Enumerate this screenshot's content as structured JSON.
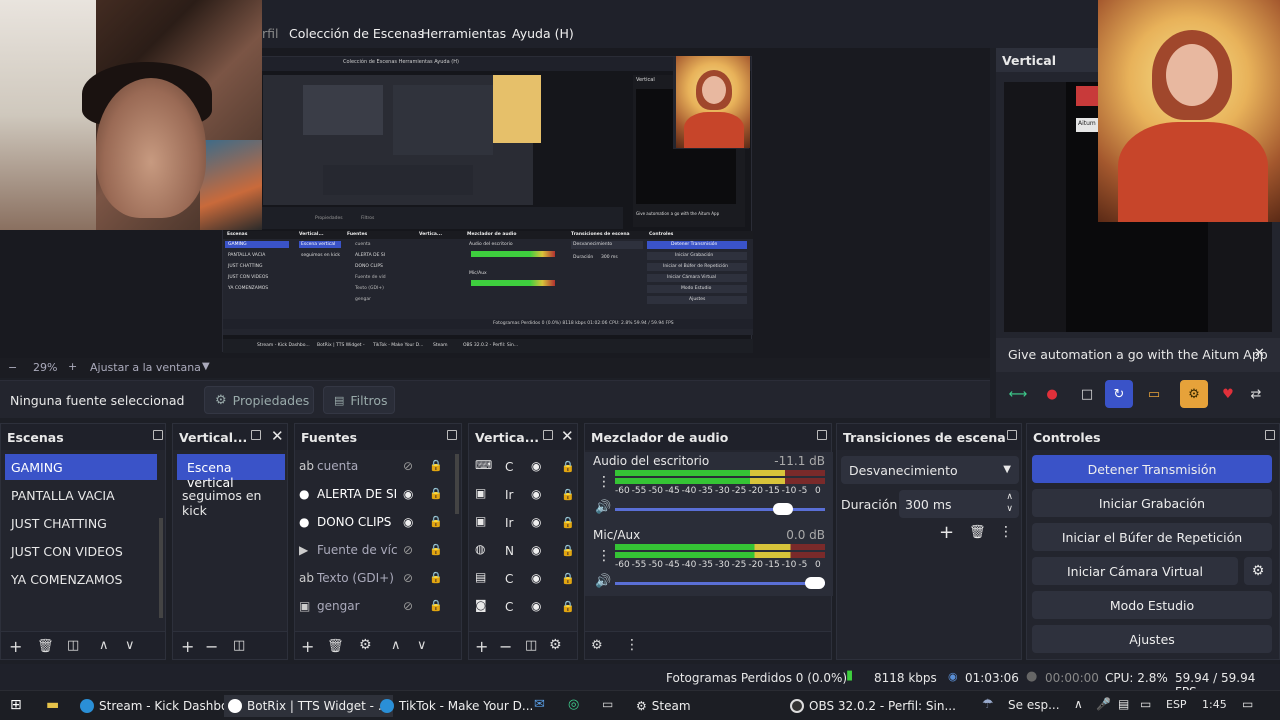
{
  "menu": {
    "partial": "rfil",
    "items": [
      "Colección de Escenas",
      "Herramientas",
      "Ayuda (H)"
    ]
  },
  "zoom": {
    "minus": "−",
    "value": "29%",
    "plus": "+",
    "fit_label": "Ajustar a la ventana",
    "chev": "▼"
  },
  "properties_bar": {
    "no_source": "Ninguna fuente seleccionad",
    "properties_label": "Propiedades",
    "filters_label": "Filtros"
  },
  "vertical": {
    "title": "Vertical",
    "banner_text": "Give automation a go with the Aitum App",
    "banner_close": "✕",
    "mini_badge": "Aitum"
  },
  "scenes": {
    "title": "Escenas",
    "items": [
      "GAMING",
      "PANTALLA VACIA",
      "JUST CHATTING",
      "JUST CON VIDEOS",
      "YA COMENZAMOS"
    ],
    "selected": 0
  },
  "vertical_scenes": {
    "title": "Vertical...",
    "items": [
      "Escena vertical",
      "seguimos en kick"
    ],
    "selected": 0
  },
  "sources": {
    "title": "Fuentes",
    "items": [
      {
        "icon": "ab",
        "name": "cuenta",
        "visible": false
      },
      {
        "icon": "●",
        "name": "ALERTA DE SI",
        "visible": true
      },
      {
        "icon": "●",
        "name": "DONO CLIPS",
        "visible": true
      },
      {
        "icon": "▶",
        "name": "Fuente de víc",
        "visible": false
      },
      {
        "icon": "ab",
        "name": "Texto (GDI+)",
        "visible": false
      },
      {
        "icon": "▣",
        "name": "gengar",
        "visible": false
      }
    ]
  },
  "vertical_sources": {
    "title": "Vertica...",
    "items": [
      "C",
      "Ir",
      "Ir",
      "N",
      "C",
      "C"
    ]
  },
  "mixer": {
    "title": "Mezclador de audio",
    "channels": [
      {
        "name": "Audio del escritorio",
        "db": "-11.1 dB",
        "level": 0.92,
        "volume": 0.83
      },
      {
        "name": "Mic/Aux",
        "db": "0.0 dB",
        "level": 0.95,
        "volume": 1.0
      }
    ],
    "ticks": [
      "-60",
      "-55",
      "-50",
      "-45",
      "-40",
      "-35",
      "-30",
      "-25",
      "-20",
      "-15",
      "-10",
      "-5",
      "0"
    ]
  },
  "transitions": {
    "title": "Transiciones de escena",
    "selected": "Desvanecimiento",
    "duration_label": "Duración",
    "duration_value": "300 ms"
  },
  "controls": {
    "title": "Controles",
    "buttons": [
      "Detener Transmisión",
      "Iniciar Grabación",
      "Iniciar el Búfer de Repetición",
      "Iniciar Cámara Virtual",
      "Modo Estudio",
      "Ajustes"
    ]
  },
  "status": {
    "dropped": "Fotogramas Perdidos 0 (0.0%)",
    "bitrate": "8118 kbps",
    "stream_time": "01:03:06",
    "rec_time": "00:00:00",
    "cpu": "CPU: 2.8%",
    "fps": "59.94 / 59.94 FPS"
  },
  "taskbar": {
    "items": [
      "Stream - Kick Dashbo...",
      "BotRix | TTS Widget - ...",
      "TikTok - Make Your D...",
      "Steam",
      "OBS 32.0.2 - Perfil: Sin..."
    ],
    "weather": "Se esp...",
    "lang": "ESP",
    "time": "1:45"
  },
  "nested": {
    "menu": "Colección de Escenas   Herramientas   Ayuda (H)",
    "banner": "Give automation a go with the Aitum App",
    "scenes": [
      "GAMING",
      "PANTALLA VACIA",
      "JUST CHATTING",
      "JUST CON VIDEOS",
      "YA COMENZAMOS"
    ],
    "controls": [
      "Detener Transmisión",
      "Iniciar Grabación",
      "Iniciar el Búfer de Repetición",
      "Iniciar Cámara Virtual",
      "Modo Estudio",
      "Ajustes"
    ],
    "vert_label": "Vertical",
    "props_label": "Propiedades",
    "filters_label": "Filtros",
    "source_sel": "te seleccionad",
    "vert_items": [
      "Escena vertical",
      "seguimos en kick"
    ],
    "sources": [
      "cuenta",
      "ALERTA DE SI",
      "DONO CLIPS",
      "Fuente de víd",
      "Texto (GDI+)",
      "gengar"
    ],
    "headers": [
      "Escenas",
      "Vertical...",
      "Fuentes",
      "Vertica...",
      "Mezclador de audio",
      "Transiciones de escena",
      "Controles"
    ],
    "mixer_labels": [
      "Audio del escritorio",
      "Mic/Aux"
    ],
    "transition": "Desvanecimiento",
    "duration": "Duración",
    "duration_value": "300 ms",
    "status": "Fotogramas Perdidos 0 (0.0%)   8118 kbps   01:02:06   CPU: 2.8%   59.94 / 59.94 FPS",
    "taskbar": [
      "Stream - Kick Dashbo...",
      "BotRix | TTS Widget -",
      "TikTok - Make Your D...",
      "Steam",
      "OBS 32.0.2 - Perfil: Sin..."
    ]
  }
}
